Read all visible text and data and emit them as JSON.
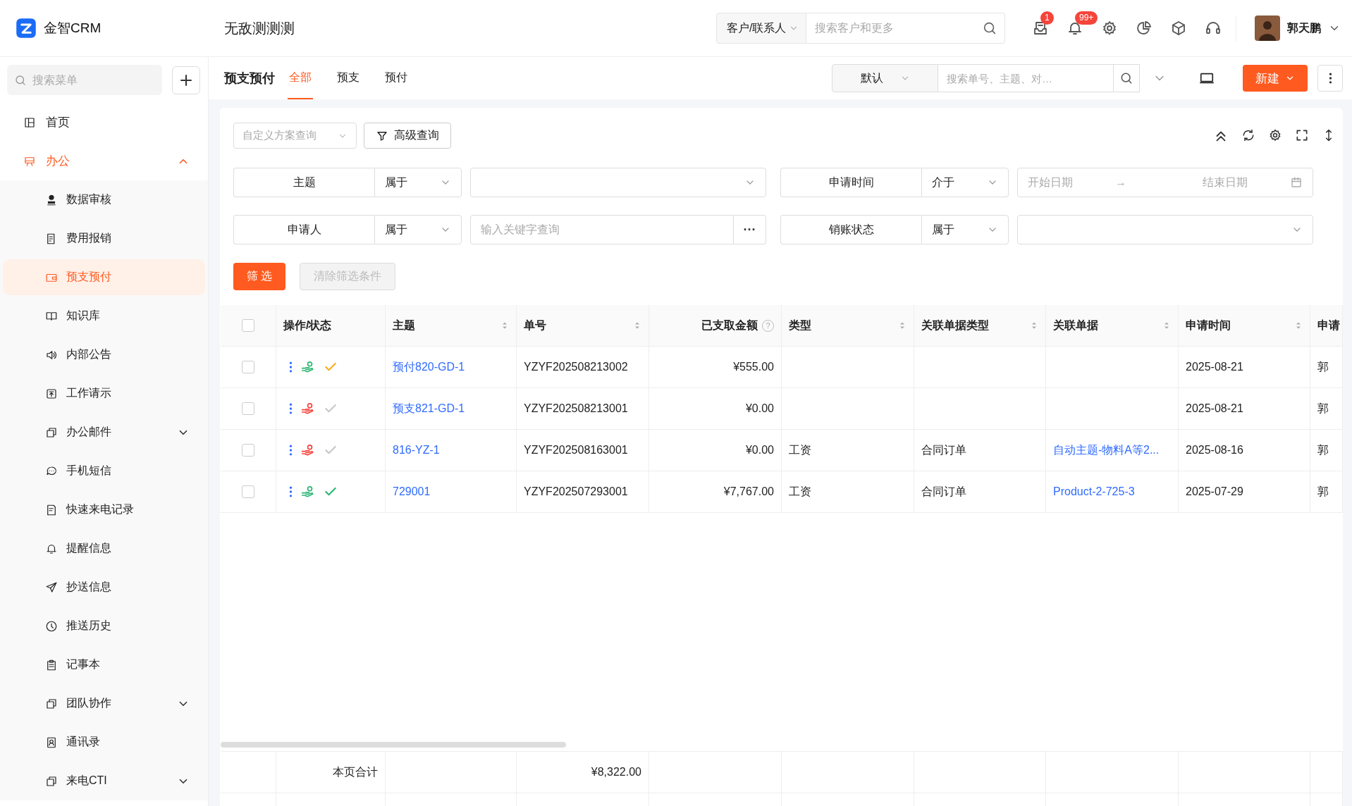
{
  "app": {
    "name": "金智CRM"
  },
  "header": {
    "title": "无敌测测测",
    "search_scope": "客户/联系人",
    "search_placeholder": "搜索客户和更多",
    "messages_badge": "1",
    "alerts_badge": "99+",
    "user_name": "郭天鹏"
  },
  "sidebar": {
    "search_placeholder": "搜索菜单",
    "items": [
      {
        "label": "首页",
        "selected": false
      },
      {
        "label": "办公",
        "selected": false,
        "expanded": true,
        "children": [
          {
            "label": "数据审核",
            "selected": false
          },
          {
            "label": "费用报销",
            "selected": false
          },
          {
            "label": "预支预付",
            "selected": true
          },
          {
            "label": "知识库",
            "selected": false
          },
          {
            "label": "内部公告",
            "selected": false
          },
          {
            "label": "工作请示",
            "selected": false
          },
          {
            "label": "办公邮件",
            "selected": false,
            "expanded": false
          },
          {
            "label": "手机短信",
            "selected": false
          },
          {
            "label": "快速来电记录",
            "selected": false
          },
          {
            "label": "提醒信息",
            "selected": false
          },
          {
            "label": "抄送信息",
            "selected": false
          },
          {
            "label": "推送历史",
            "selected": false
          },
          {
            "label": "记事本",
            "selected": false
          },
          {
            "label": "团队协作",
            "selected": false,
            "expanded": false
          },
          {
            "label": "通讯录",
            "selected": false
          },
          {
            "label": "来电CTI",
            "selected": false,
            "expanded": false
          }
        ]
      }
    ]
  },
  "page": {
    "title": "预支预付",
    "tabs": [
      {
        "label": "全部",
        "selected": true
      },
      {
        "label": "预支",
        "selected": false
      },
      {
        "label": "预付",
        "selected": false
      }
    ],
    "view_select": "默认",
    "search_placeholder": "搜索单号、主题、对…",
    "new_button": "新建"
  },
  "filter_panel": {
    "scheme_placeholder": "自定义方案查询",
    "advanced_button": "高级查询",
    "filters": [
      {
        "field": "主题",
        "operator": "属于",
        "kind": "select"
      },
      {
        "field": "申请时间",
        "operator": "介于",
        "kind": "date_range",
        "start_placeholder": "开始日期",
        "separator": "→",
        "end_placeholder": "结束日期"
      },
      {
        "field": "申请人",
        "operator": "属于",
        "kind": "keyword",
        "placeholder": "输入关键字查询",
        "more": "···"
      },
      {
        "field": "销账状态",
        "operator": "属于",
        "kind": "select"
      }
    ],
    "apply_button": "筛 选",
    "clear_button": "清除筛选条件",
    "clear_disabled": true
  },
  "table": {
    "select_all_checked": false,
    "columns": [
      {
        "label": "操作/状态",
        "kind": "ops",
        "sortable": false
      },
      {
        "label": "主题",
        "kind": "link",
        "sortable": true
      },
      {
        "label": "单号",
        "kind": "text",
        "sortable": true
      },
      {
        "label": "已支取金额",
        "kind": "money",
        "sortable": false,
        "help": "?"
      },
      {
        "label": "类型",
        "kind": "text",
        "sortable": true
      },
      {
        "label": "关联单据类型",
        "kind": "text",
        "sortable": true
      },
      {
        "label": "关联单据",
        "kind": "link",
        "sortable": true
      },
      {
        "label": "申请时间",
        "kind": "text",
        "sortable": true
      },
      {
        "label": "申请",
        "kind": "text"
      }
    ],
    "rows": [
      {
        "checked": false,
        "cells": [
          {
            "status_icons": [
              {
                "kind": "hand",
                "color": "#2bb673"
              },
              {
                "kind": "check",
                "color": "#f7ae1e"
              }
            ]
          },
          {
            "text": "预付820-GD-1"
          },
          {
            "text": "YZYF202508213002"
          },
          {
            "text": "¥555.00"
          },
          {},
          {},
          {},
          {
            "text": "2025-08-21"
          },
          {
            "text": "郭"
          }
        ]
      },
      {
        "checked": false,
        "cells": [
          {
            "status_icons": [
              {
                "kind": "hand",
                "color": "#f5443b"
              },
              {
                "kind": "check",
                "color": "#c8c8c8"
              }
            ]
          },
          {
            "text": "预支821-GD-1"
          },
          {
            "text": "YZYF202508213001"
          },
          {
            "text": "¥0.00"
          },
          {},
          {},
          {},
          {
            "text": "2025-08-21"
          },
          {
            "text": "郭"
          }
        ]
      },
      {
        "checked": false,
        "cells": [
          {
            "status_icons": [
              {
                "kind": "hand",
                "color": "#f5443b"
              },
              {
                "kind": "check",
                "color": "#c8c8c8"
              }
            ]
          },
          {
            "text": "816-YZ-1"
          },
          {
            "text": "YZYF202508163001"
          },
          {
            "text": "¥0.00"
          },
          {
            "text": "工资"
          },
          {
            "text": "合同订单"
          },
          {
            "text": "自动主题-物料A等2..."
          },
          {
            "text": "2025-08-16"
          },
          {
            "text": "郭"
          }
        ]
      },
      {
        "checked": false,
        "cells": [
          {
            "status_icons": [
              {
                "kind": "hand",
                "color": "#2bb673"
              },
              {
                "kind": "check",
                "color": "#2bb673"
              }
            ]
          },
          {
            "text": "729001"
          },
          {
            "text": "YZYF202507293001"
          },
          {
            "text": "¥7,767.00"
          },
          {
            "text": "工资"
          },
          {
            "text": "合同订单"
          },
          {
            "text": "Product-2-725-3"
          },
          {
            "text": "2025-07-29"
          },
          {
            "text": "郭"
          }
        ]
      }
    ],
    "total": {
      "label": "本页合计",
      "amount": "¥8,322.00"
    }
  }
}
